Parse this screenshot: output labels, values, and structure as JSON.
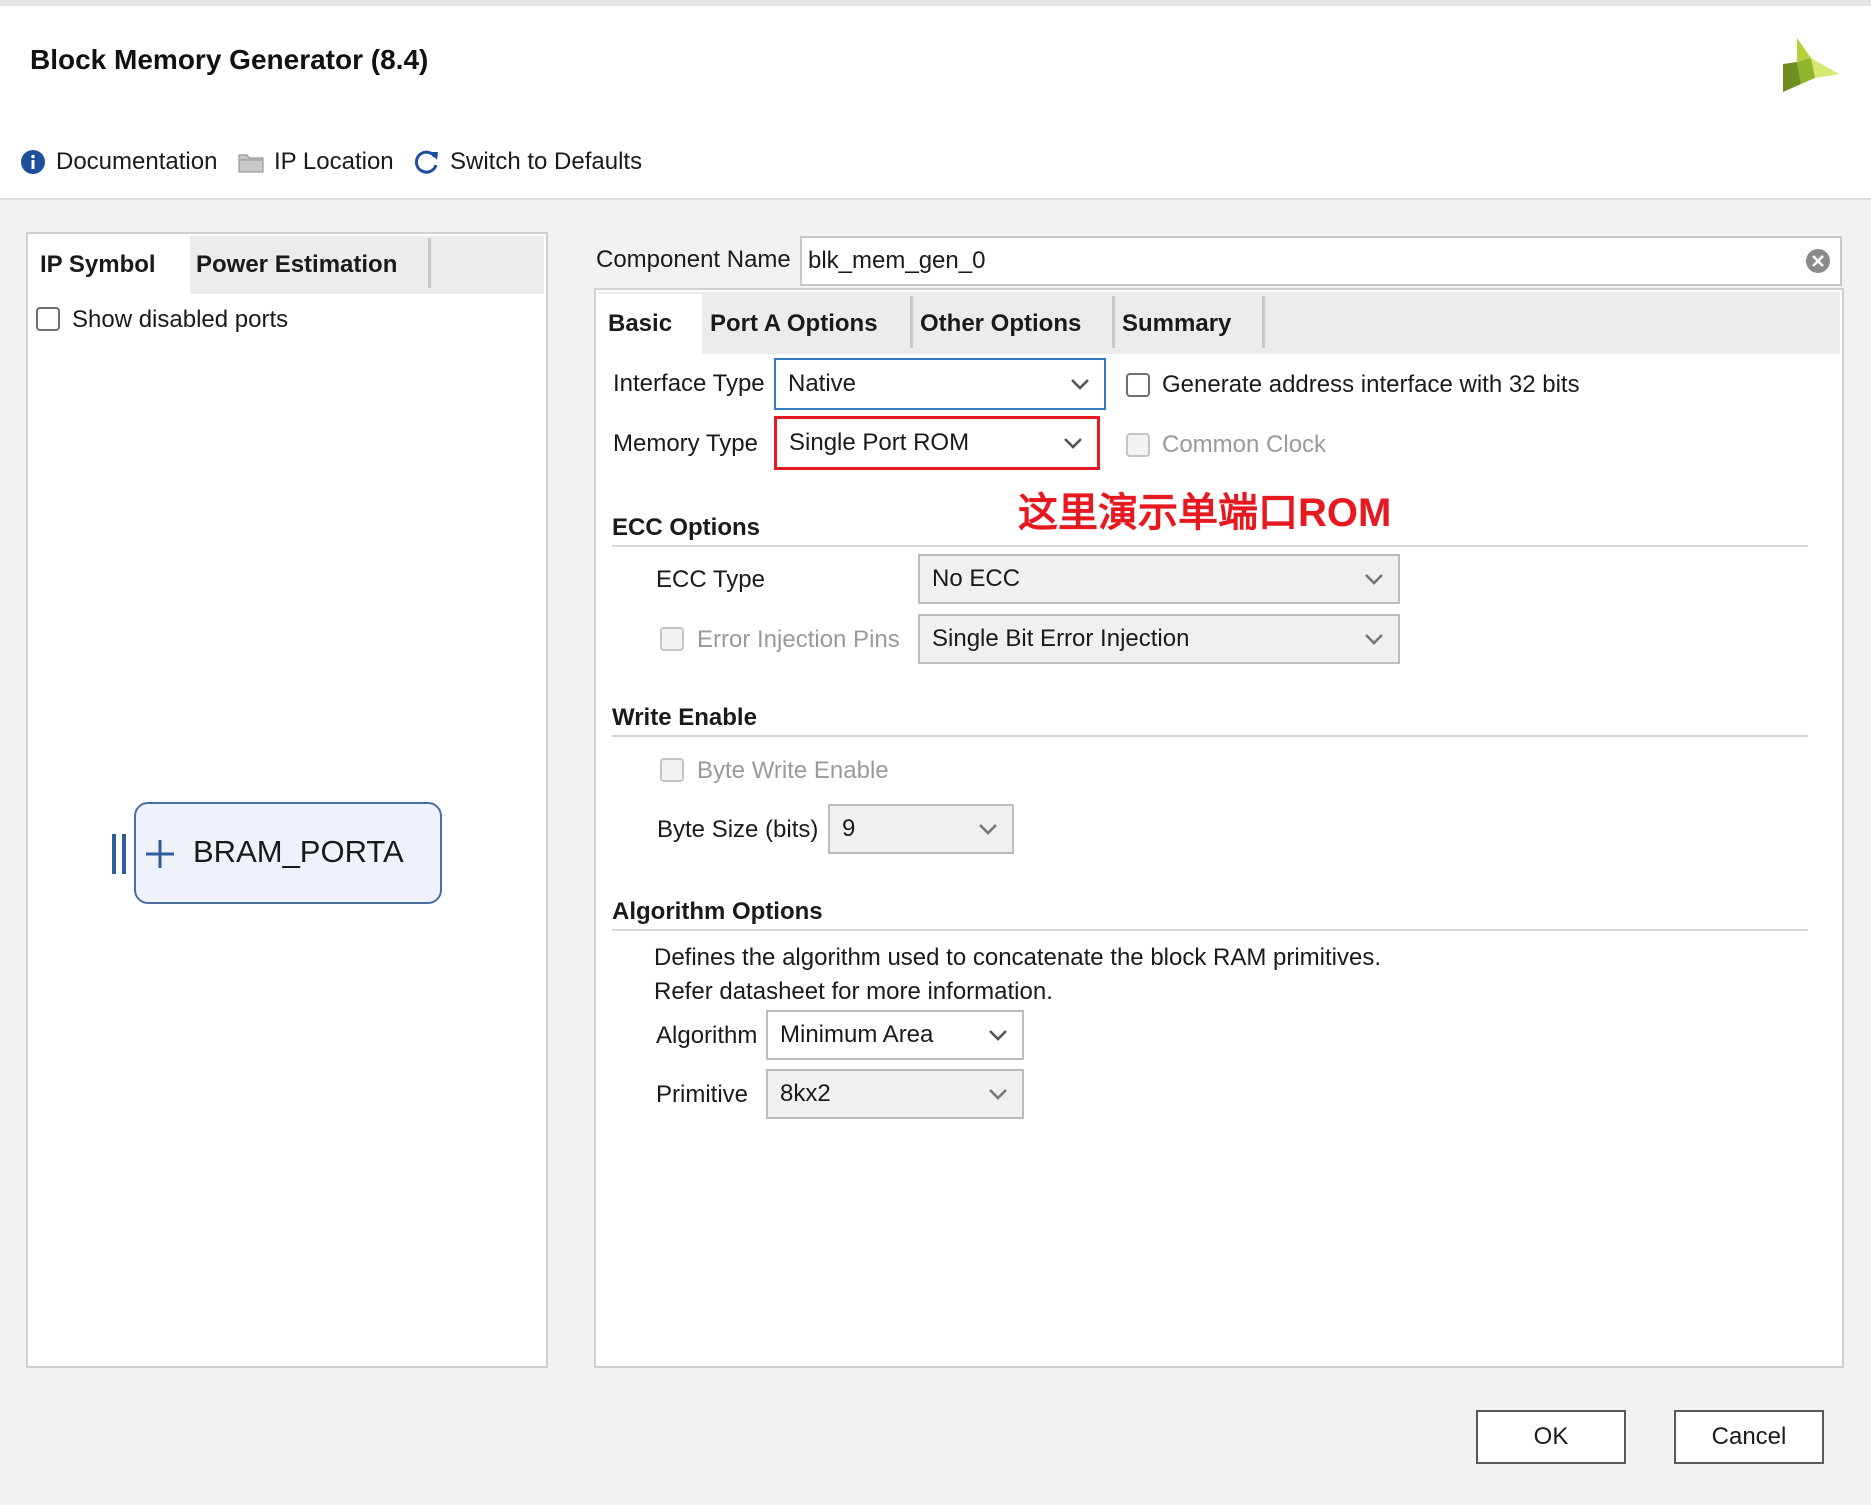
{
  "window": {
    "title": "Block Memory Generator (8.4)"
  },
  "toolbar": {
    "documentation": "Documentation",
    "ip_location": "IP Location",
    "switch_defaults": "Switch to Defaults"
  },
  "left_panel": {
    "tabs": [
      "IP Symbol",
      "Power Estimation"
    ],
    "show_disabled_ports": "Show disabled ports",
    "symbol_label": "BRAM_PORTA"
  },
  "component": {
    "label": "Component Name",
    "value": "blk_mem_gen_0"
  },
  "right_tabs": [
    "Basic",
    "Port A Options",
    "Other Options",
    "Summary"
  ],
  "basic": {
    "interface_type_label": "Interface Type",
    "interface_type_value": "Native",
    "gen_addr_label": "Generate address interface with 32 bits",
    "memory_type_label": "Memory Type",
    "memory_type_value": "Single Port ROM",
    "common_clock_label": "Common Clock",
    "annotation": "这里演示单端口ROM"
  },
  "ecc": {
    "section": "ECC Options",
    "type_label": "ECC Type",
    "type_value": "No ECC",
    "error_pins_label": "Error Injection Pins",
    "error_pins_value": "Single Bit Error Injection"
  },
  "write_enable": {
    "section": "Write Enable",
    "byte_write_label": "Byte Write Enable",
    "byte_size_label": "Byte Size (bits)",
    "byte_size_value": "9"
  },
  "algorithm": {
    "section": "Algorithm Options",
    "desc1": "Defines the algorithm used to concatenate the block RAM primitives.",
    "desc2": "Refer datasheet for more information.",
    "algorithm_label": "Algorithm",
    "algorithm_value": "Minimum Area",
    "primitive_label": "Primitive",
    "primitive_value": "8kx2"
  },
  "buttons": {
    "ok": "OK",
    "cancel": "Cancel"
  },
  "colors": {
    "accent_blue": "#3a78c9",
    "annotation_red": "#e5191f",
    "logo_green": "#8db52e"
  }
}
